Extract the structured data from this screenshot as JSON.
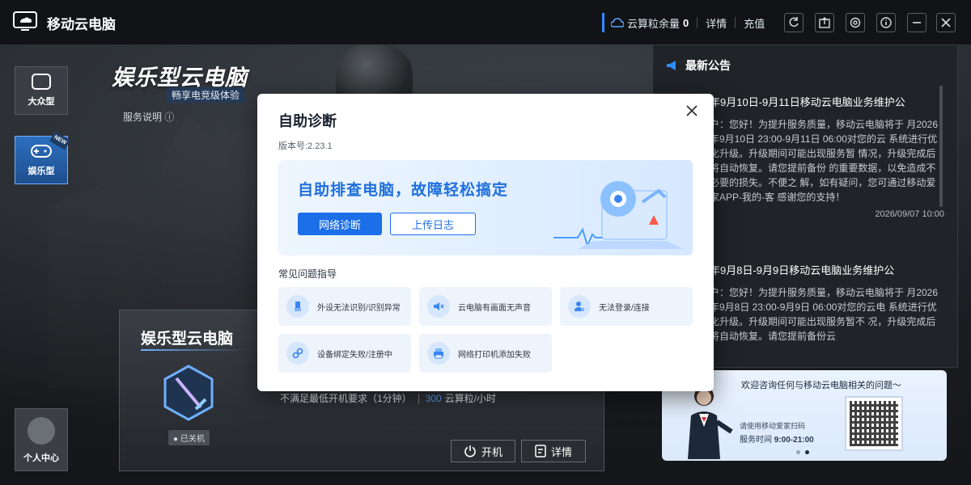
{
  "app": {
    "title": "移动云电脑"
  },
  "balance": {
    "label": "云算粒余量",
    "value": "0",
    "detail": "详情",
    "recharge": "充值"
  },
  "rail": {
    "popular": "大众型",
    "entertainment": "娱乐型",
    "new_badge": "NEW",
    "profile": "个人中心"
  },
  "brand": {
    "title": "娱乐型云电脑",
    "subtitle": "畅享电竞级体验",
    "service": "服务说明 ⓘ"
  },
  "card": {
    "title": "娱乐型云电脑",
    "status": "● 已关机",
    "requirement": "不满足最低开机要求（1分钟）",
    "price_value": "300",
    "price_unit": "云算粒/小时",
    "start": "开机",
    "details": "详情"
  },
  "announcements": {
    "heading": "最新公告",
    "items": [
      {
        "title": "年9月10日-9月11日移动云电脑业务维护公",
        "body": "户：您好！为提升服务质量，移动云电脑将于 月2026年9月10日 23:00-9月11日 06:00对您的云 系统进行优化升级。升级期间可能出现服务暂 情况，升级完成后将自动恢复。请您提前备份 的重要数据，以免造成不必要的损失。不便之 解，如有疑问，您可通过移动爱家APP-我的-客 感谢您的支持！",
        "date": "2026/09/07 10:00"
      },
      {
        "title": "年9月8日-9月9日移动云电脑业务维护公",
        "body": "户：您好！为提升服务质量，移动云电脑将于 月2026年9月8日 23:00-9月9日 06:00对您的云电 系统进行优化升级。升级期间可能出现服务暂不 况，升级完成后将自动恢复。请您提前备份云",
        "date": ""
      }
    ]
  },
  "promo": {
    "title": "欢迎咨询任何与移动云电脑相关的问题～",
    "line1": "请使用移动爱家扫码",
    "hours_label": "服务时间",
    "hours": "9:00-21:00"
  },
  "dialog": {
    "title": "自助诊断",
    "version": "版本号:2.23.1",
    "banner_title": "自助排查电脑，故障轻松搞定",
    "network_btn": "网络诊断",
    "upload_btn": "上传日志",
    "faq_heading": "常见问题指导",
    "faq": [
      {
        "label": "外设无法识别/识别异常",
        "icon": "usb-icon"
      },
      {
        "label": "云电脑有画面无声音",
        "icon": "mute-icon"
      },
      {
        "label": "无法登录/连接",
        "icon": "user-lock-icon"
      },
      {
        "label": "设备绑定失败/注册中",
        "icon": "link-icon"
      },
      {
        "label": "网络打印机添加失败",
        "icon": "printer-icon"
      }
    ]
  },
  "colors": {
    "accent": "#1c6fe8",
    "primary_blue": "#2f8cff",
    "banner_text": "#1f6fdc"
  }
}
